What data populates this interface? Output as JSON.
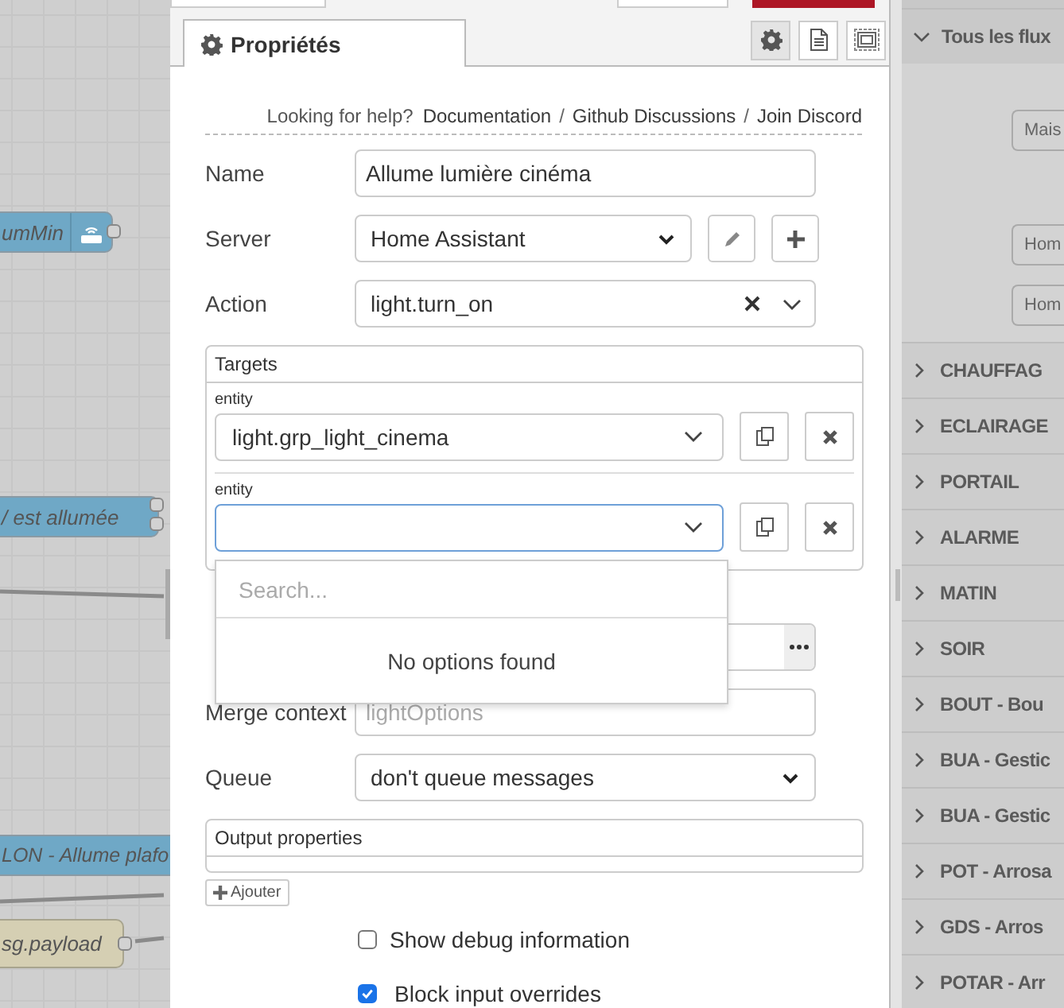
{
  "canvas": {
    "nodes": [
      {
        "label": "umMin",
        "kind": "service",
        "color": "#6fa8c6"
      },
      {
        "label": "/ est allumée",
        "kind": "event",
        "color": "#6fa8c6"
      },
      {
        "label": "LON - Allume plafo",
        "kind": "action",
        "color": "#6fa8c6"
      },
      {
        "label": "sg.payload",
        "kind": "debug",
        "color": "#d5cfb3"
      }
    ]
  },
  "editor": {
    "tabs": [
      {
        "label": "Propriétés",
        "selected": true
      }
    ],
    "tool_buttons": [
      {
        "kind": "gear",
        "selected": true
      },
      {
        "kind": "document",
        "selected": false
      },
      {
        "kind": "frame",
        "selected": false
      }
    ],
    "help": [
      {
        "kind": "text",
        "text": "Looking for help?"
      },
      {
        "kind": "link",
        "text": "Documentation"
      },
      {
        "kind": "separator",
        "text": "/"
      },
      {
        "kind": "link",
        "text": "Github Discussions"
      },
      {
        "kind": "separator",
        "text": "/"
      },
      {
        "kind": "link",
        "text": "Join Discord"
      }
    ],
    "rows": [
      {
        "kind": "text",
        "label": "Name",
        "value": "Allume lumière cinéma"
      },
      {
        "kind": "select",
        "label": "Server",
        "value": "Home Assistant",
        "buttons": [
          {
            "kind": "edit"
          },
          {
            "kind": "add"
          }
        ]
      },
      {
        "kind": "combo",
        "label": "Action",
        "value": "light.turn_on"
      },
      {
        "kind": "targets",
        "title": "Targets",
        "entities": [
          {
            "label": "entity",
            "value": "light.grp_light_cinema",
            "focused": false
          },
          {
            "label": "entity",
            "focused": true
          }
        ]
      },
      {
        "kind": "covered-field"
      },
      {
        "kind": "text",
        "label": "Merge context",
        "placeholder": "lightOptions"
      },
      {
        "kind": "select",
        "label": "Queue",
        "value": "don't queue messages"
      },
      {
        "kind": "output",
        "title": "Output properties",
        "add_button": "Ajouter"
      },
      {
        "kind": "checkbox",
        "label": "Show debug information",
        "checked": false
      },
      {
        "kind": "checkbox",
        "label": "Block input overrides",
        "checked": true
      }
    ],
    "dropdown": {
      "placeholder": "Search...",
      "message": "No options found"
    }
  },
  "sidebar": {
    "groups": [
      {
        "label": "Tous les flux",
        "expanded": true,
        "children": [
          {
            "label": "Mais"
          },
          {
            "label": "Hom"
          },
          {
            "label": "Hom"
          }
        ]
      },
      {
        "label": "CHAUFFAG",
        "expanded": false
      },
      {
        "label": "ECLAIRAGE",
        "expanded": false
      },
      {
        "label": "PORTAIL",
        "expanded": false
      },
      {
        "label": "ALARME",
        "expanded": false
      },
      {
        "label": "MATIN",
        "expanded": false
      },
      {
        "label": "SOIR",
        "expanded": false
      },
      {
        "label": "BOUT - Bou",
        "expanded": false
      },
      {
        "label": "BUA - Gestic",
        "expanded": false
      },
      {
        "label": "BUA - Gestic",
        "expanded": false
      },
      {
        "label": "POT - Arrosa",
        "expanded": false
      },
      {
        "label": "GDS - Arros",
        "expanded": false
      },
      {
        "label": "POTAR - Arr",
        "expanded": false
      }
    ]
  }
}
